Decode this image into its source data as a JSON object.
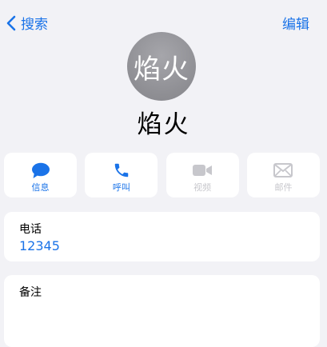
{
  "nav": {
    "back_label": "搜索",
    "edit_label": "编辑"
  },
  "contact": {
    "avatar_text": "焰火",
    "name": "焰火"
  },
  "actions": [
    {
      "label": "信息",
      "icon": "message-icon",
      "enabled": true
    },
    {
      "label": "呼叫",
      "icon": "phone-icon",
      "enabled": true
    },
    {
      "label": "视频",
      "icon": "video-icon",
      "enabled": false
    },
    {
      "label": "邮件",
      "icon": "mail-icon",
      "enabled": false
    }
  ],
  "phone": {
    "label": "电话",
    "value": "12345"
  },
  "notes": {
    "label": "备注"
  },
  "colors": {
    "accent": "#1a73e8",
    "background": "#f2f2f6",
    "avatar": "#8e8e93",
    "disabled": "#c7c7cc"
  }
}
